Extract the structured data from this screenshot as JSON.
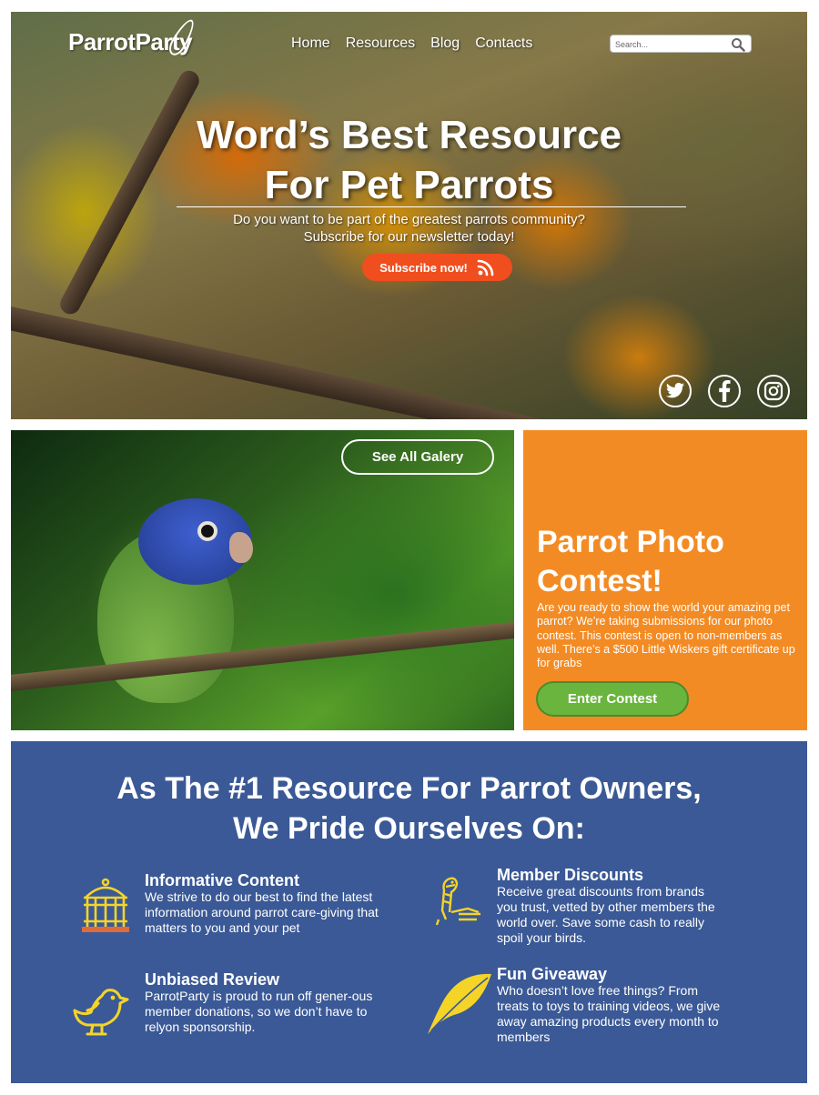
{
  "header": {
    "logo": "ParrotParty",
    "nav": [
      "Home",
      "Resources",
      "Blog",
      "Contacts"
    ],
    "search_placeholder": "Search..."
  },
  "hero": {
    "title_line1": "Word’s Best Resource",
    "title_line2": "For Pet Parrots",
    "subtitle_line1": "Do you want to be part of the greatest parrots community?",
    "subtitle_line2": "Subscribe for our newsletter today!",
    "cta_label": "Subscribe now!",
    "social_icons": [
      "twitter-icon",
      "facebook-icon",
      "instagram-icon"
    ]
  },
  "gallery": {
    "button_label": "See All Galery"
  },
  "contest": {
    "title_line1": "Parrot Photo",
    "title_line2": "Contest!",
    "body": "Are you ready to show the world your amazing pet parrot? We’re taking submissions for our photo contest. This contest is open to non-members as well. There’s a $500 Little Wiskers gift certificate up for grabs",
    "button_label": "Enter Contest",
    "bg_color": "#f38b24",
    "button_color": "#6ab53d"
  },
  "features": {
    "heading_line1": "As The #1 Resource For Parrot Owners,",
    "heading_line2": "We Pride Ourselves On:",
    "bg_color": "#3a5996",
    "icon_color": "#f5d428",
    "items": [
      {
        "title": "Informative Content",
        "body": "We strive to do our best to find the latest information around parrot care-giving that matters to you and your pet",
        "icon": "birdcage-icon"
      },
      {
        "title": "Member Discounts",
        "body": "Receive great discounts from brands you trust, vetted by other members the world over. Save some cash to really spoil your birds.",
        "icon": "parrot-perch-icon"
      },
      {
        "title": "Unbiased Review",
        "body": "ParrotParty is proud to run off gener-ous member donations, so we don’t have to relyon sponsorship.",
        "icon": "bird-icon"
      },
      {
        "title": "Fun Giveaway",
        "body": "Who doesn’t love free things? From treats to toys to training videos, we give away amazing products every month to members",
        "icon": "feather-icon"
      }
    ]
  }
}
